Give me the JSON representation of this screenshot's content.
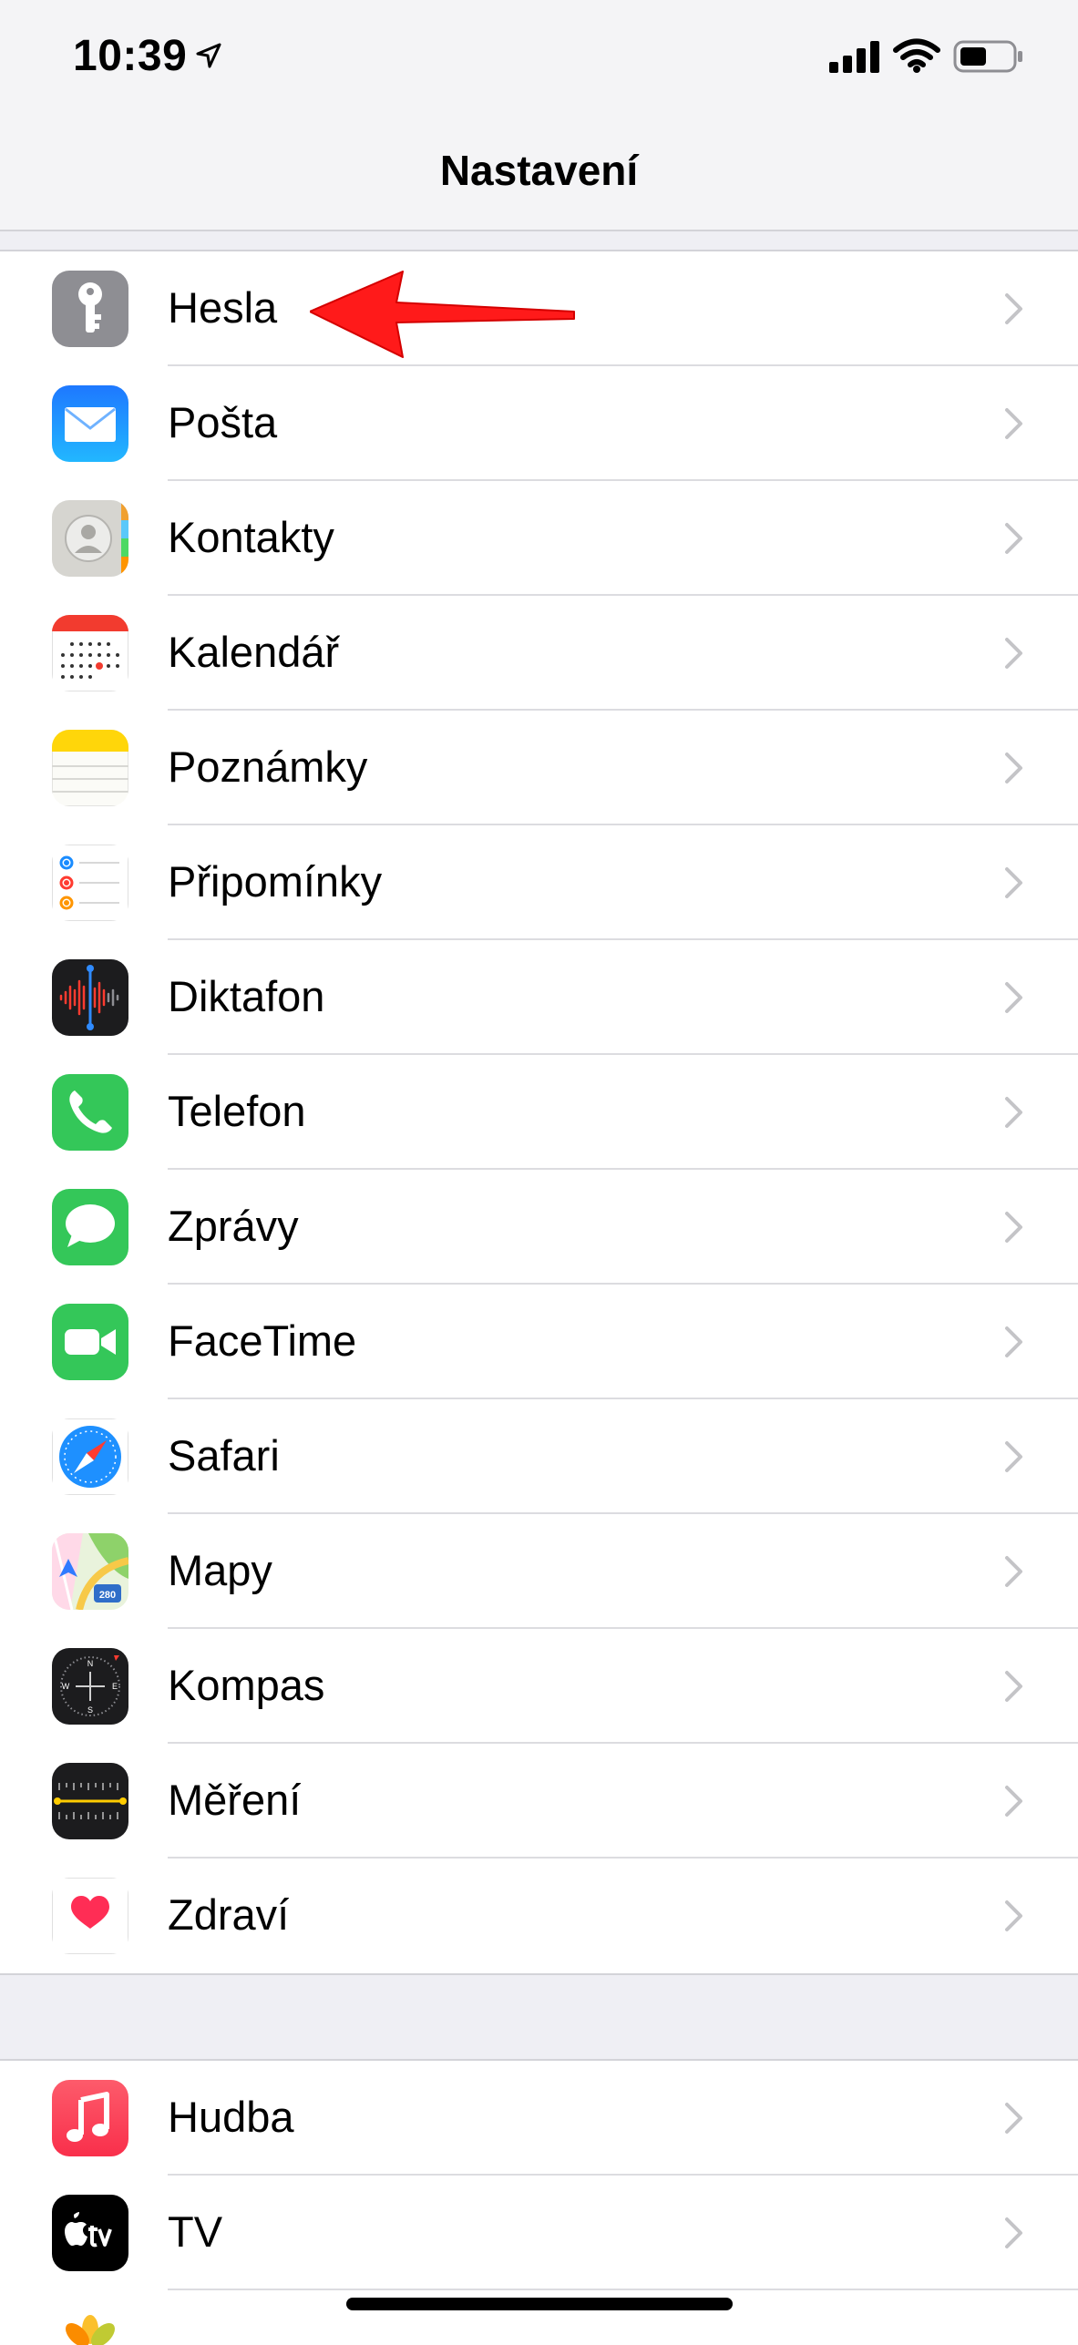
{
  "status_bar": {
    "time": "10:39",
    "icons": [
      "location-arrow-icon",
      "cellular-signal-icon",
      "wifi-icon",
      "battery-icon"
    ]
  },
  "nav": {
    "title": "Nastavení"
  },
  "annotation": {
    "color": "#ff1a1a",
    "target": "Hesla"
  },
  "groups": [
    {
      "items": [
        {
          "label": "Hesla",
          "icon": "key-icon",
          "color": "#8e8e93"
        },
        {
          "label": "Pošta",
          "icon": "mail-icon",
          "color": "#1a8cff"
        },
        {
          "label": "Kontakty",
          "icon": "contacts-icon",
          "color": "#c8c7c2"
        },
        {
          "label": "Kalendář",
          "icon": "calendar-icon",
          "color": "#ffffff"
        },
        {
          "label": "Poznámky",
          "icon": "notes-icon",
          "color": "#ffd60a"
        },
        {
          "label": "Připomínky",
          "icon": "reminders-icon",
          "color": "#ffffff"
        },
        {
          "label": "Diktafon",
          "icon": "voice-memos-icon",
          "color": "#1c1c1e"
        },
        {
          "label": "Telefon",
          "icon": "phone-icon",
          "color": "#34c759"
        },
        {
          "label": "Zprávy",
          "icon": "messages-icon",
          "color": "#34c759"
        },
        {
          "label": "FaceTime",
          "icon": "facetime-icon",
          "color": "#34c759"
        },
        {
          "label": "Safari",
          "icon": "safari-icon",
          "color": "#1e90ff"
        },
        {
          "label": "Mapy",
          "icon": "maps-icon",
          "color": "#7ed36b"
        },
        {
          "label": "Kompas",
          "icon": "compass-icon",
          "color": "#1c1c1e"
        },
        {
          "label": "Měření",
          "icon": "measure-icon",
          "color": "#1c1c1e"
        },
        {
          "label": "Zdraví",
          "icon": "health-icon",
          "color": "#ffffff"
        }
      ]
    },
    {
      "items": [
        {
          "label": "Hudba",
          "icon": "music-icon",
          "color": "#fc3c44"
        },
        {
          "label": "TV",
          "icon": "apple-tv-icon",
          "color": "#000000"
        }
      ]
    }
  ]
}
